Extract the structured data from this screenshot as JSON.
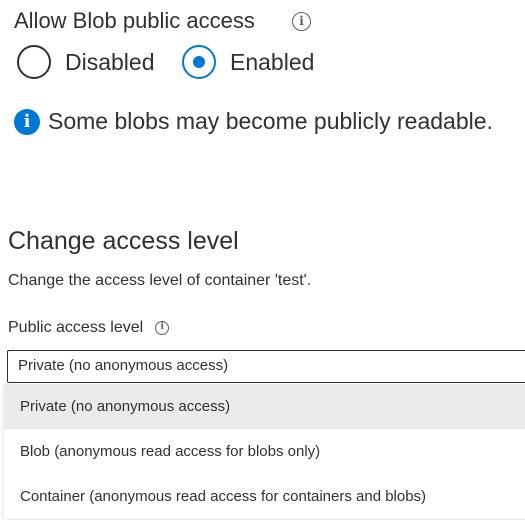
{
  "blob_access": {
    "title": "Allow Blob public access",
    "options": [
      {
        "label": "Disabled",
        "checked": false
      },
      {
        "label": "Enabled",
        "checked": true
      }
    ],
    "notice": "Some blobs may become publicly readable."
  },
  "change_access": {
    "title": "Change access level",
    "description": "Change the access level of container 'test'.",
    "field_label": "Public access level",
    "selected_value": "Private (no anonymous access)",
    "options": [
      {
        "label": "Private (no anonymous access)",
        "selected": true
      },
      {
        "label": "Blob (anonymous read access for blobs only)",
        "selected": false
      },
      {
        "label": "Container (anonymous read access for containers and blobs)",
        "selected": false
      }
    ]
  },
  "colors": {
    "accent": "#0078d4",
    "text": "#323130",
    "selected_option_bg": "#edebe9"
  },
  "icons": [
    "info-outline-icon",
    "info-filled-icon"
  ]
}
